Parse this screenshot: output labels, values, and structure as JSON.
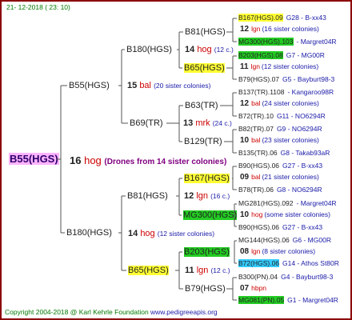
{
  "header": {
    "date": "21- 12-2018 ( 23: 10)"
  },
  "footer": {
    "copyright": "Copyright 2004-2018 @ Karl Kehrle Foundation",
    "site": "www.pedigreeapis.org"
  },
  "root": {
    "queen": "B55(HGS)",
    "num": "16",
    "drone": "hog",
    "note": "Drones from 14 sister colonies"
  },
  "g1": [
    {
      "queen": "B55(HGS)",
      "num": "15",
      "drone": "bal",
      "note": "(20 sister colonies)"
    },
    {
      "queen": "B180(HGS)",
      "num": "14",
      "drone": "hog",
      "note": "(12 sister colonies)"
    }
  ],
  "g2": [
    {
      "queen": "B180(HGS)",
      "num": "14",
      "drone": "hog",
      "note": "(12 c.)"
    },
    {
      "queen": "B69(TR)",
      "num": "13",
      "drone": "mrk",
      "note": "(24 c.)"
    },
    {
      "queen": "B81(HGS)",
      "num": "12",
      "drone": "lgn",
      "note": "(16 c.)"
    },
    {
      "queen": "B65(HGS)",
      "num": "11",
      "drone": "lgn",
      "note": "(12 c.)"
    }
  ],
  "g3": [
    {
      "queen": "B81(HGS)",
      "num": "14",
      "drone": "hog",
      "note": "(12 c.)"
    },
    {
      "queen": "B65(HGS)",
      "num": "",
      "drone": "",
      "note": ""
    },
    {
      "queen": "B63(TR)",
      "num": "",
      "drone": "",
      "note": ""
    },
    {
      "queen": "B129(TR)",
      "num": "",
      "drone": "",
      "note": ""
    },
    {
      "queen": "B167(HGS)",
      "num": "",
      "drone": "",
      "note": ""
    },
    {
      "queen": "MG300(HGS)",
      "num": "",
      "drone": "",
      "note": ""
    },
    {
      "queen": "B203(HGS)",
      "num": "",
      "drone": "",
      "note": ""
    },
    {
      "queen": "B79(HGS)",
      "num": "",
      "drone": "",
      "note": ""
    }
  ],
  "g4": [
    {
      "queen": "B167(HGS).09",
      "mother": "G28 - B-xx43",
      "num": "12",
      "drone": "lgn",
      "note": "(16 sister colonies)"
    },
    {
      "queen": "MG300(HGS).103",
      "mother": "- Margret04R",
      "num": "",
      "drone": "",
      "note": ""
    },
    {
      "queen": "B203(HGS).08",
      "mother": "G7 - MG00R",
      "num": "11",
      "drone": "lgn",
      "note": "(12 sister colonies)"
    },
    {
      "queen": "B79(HGS).07",
      "mother": "G5 - Bayburt98-3",
      "num": "",
      "drone": "",
      "note": ""
    },
    {
      "queen": "B137(TR).1108",
      "mother": "- Kangaroo98R",
      "num": "12",
      "drone": "bal",
      "note": "(24 sister colonies)"
    },
    {
      "queen": "B72(TR).10",
      "mother": "G11 - NO6294R",
      "num": "",
      "drone": "",
      "note": ""
    },
    {
      "queen": "B82(TR).07",
      "mother": "G9 - NO6294R",
      "num": "10",
      "drone": "bal",
      "note": "(23 sister colonies)"
    },
    {
      "queen": "B135(TR).06",
      "mother": "G8 - Takab93aR",
      "num": "",
      "drone": "",
      "note": ""
    },
    {
      "queen": "B90(HGS).06",
      "mother": "G27 - B-xx43",
      "num": "09",
      "drone": "bal",
      "note": "(21 sister colonies)"
    },
    {
      "queen": "B78(TR).06",
      "mother": "G8 - NO6294R",
      "num": "",
      "drone": "",
      "note": ""
    },
    {
      "queen": "MG281(HGS).092",
      "mother": "- Margret04R",
      "num": "10",
      "drone": "hog",
      "note": "(some sister colonies)"
    },
    {
      "queen": "B90(HGS).06",
      "mother": "G27 - B-xx43",
      "num": "",
      "drone": "",
      "note": ""
    },
    {
      "queen": "MG144(HGS).06",
      "mother": "G6 - MG00R",
      "num": "08",
      "drone": "lgn",
      "note": "(8 sister colonies)"
    },
    {
      "queen": "B72(HGS).06",
      "mother": "G14 - Athos St80R",
      "num": "",
      "drone": "",
      "note": ""
    },
    {
      "queen": "B300(PN).04",
      "mother": "G4 - Bayburt98-3",
      "num": "07",
      "drone": "hbpn",
      "note": ""
    },
    {
      "queen": "MG081(PN).05",
      "mother": "G1 - Margret04R",
      "num": "",
      "drone": "",
      "note": ""
    }
  ],
  "colors": {
    "frame": "#8b0000",
    "root_bg": "#ffb3ff",
    "yellow": "#ffff33",
    "green": "#22cc22",
    "cyan": "#33ccff"
  }
}
